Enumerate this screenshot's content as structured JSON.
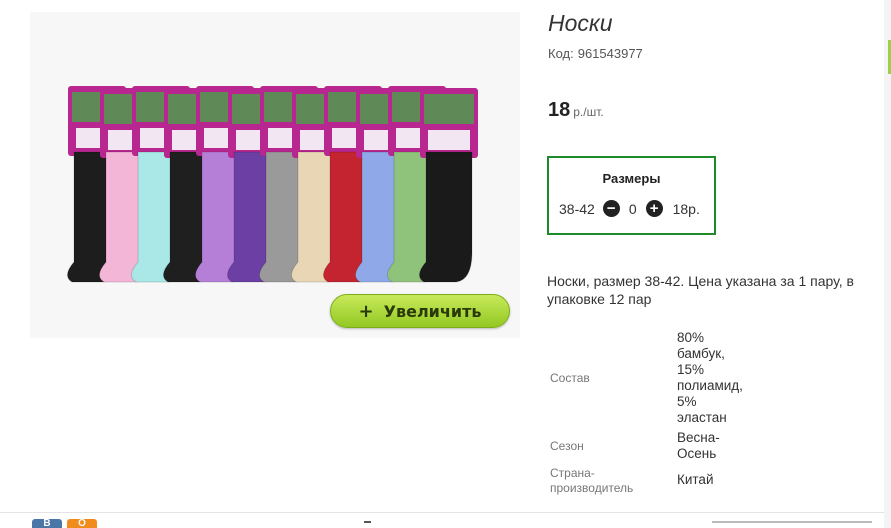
{
  "product": {
    "title": "Носки",
    "code_label": "Код:",
    "code_value": "961543977",
    "price_value": "18",
    "price_unit": "р./шт.",
    "zoom_button_label": "Увеличить",
    "zoom_button_icon": "plus-icon",
    "package_brand": "Бамбук",
    "sock_colors": [
      "#1d1d1d",
      "#f4b6d6",
      "#a9e8e6",
      "#1f1f1f",
      "#b57fd8",
      "#6b3fa3",
      "#9a9a9a",
      "#e9d6b4",
      "#c3242f",
      "#8fa8e8",
      "#8fc27a",
      "#1a1a1a"
    ]
  },
  "sizes": {
    "title": "Размеры",
    "items": [
      {
        "size": "38-42",
        "quantity": "0",
        "price": "18р."
      }
    ],
    "minus_icon": "minus-circle-icon",
    "plus_icon": "plus-circle-icon",
    "border_color": "#1f8a2a"
  },
  "description": "Носки, размер 38-42. Цена указана за 1 пару, в упаковке 12 пар",
  "specs": [
    {
      "label": "Состав",
      "value_lines": [
        "80%",
        "бамбук,",
        "15%",
        "полиамид,",
        "5%",
        "эластан"
      ]
    },
    {
      "label": "Сезон",
      "value_lines": [
        "Весна-",
        "Осень"
      ]
    },
    {
      "label_lines": [
        "Страна-",
        "производитель"
      ],
      "value_lines": [
        "Китай"
      ]
    }
  ],
  "footer": {
    "social": [
      {
        "name": "vk",
        "label": "В"
      },
      {
        "name": "ok",
        "label": "О"
      }
    ]
  },
  "colors": {
    "accent_green": "#93c823",
    "border_green": "#1f8a2a"
  }
}
